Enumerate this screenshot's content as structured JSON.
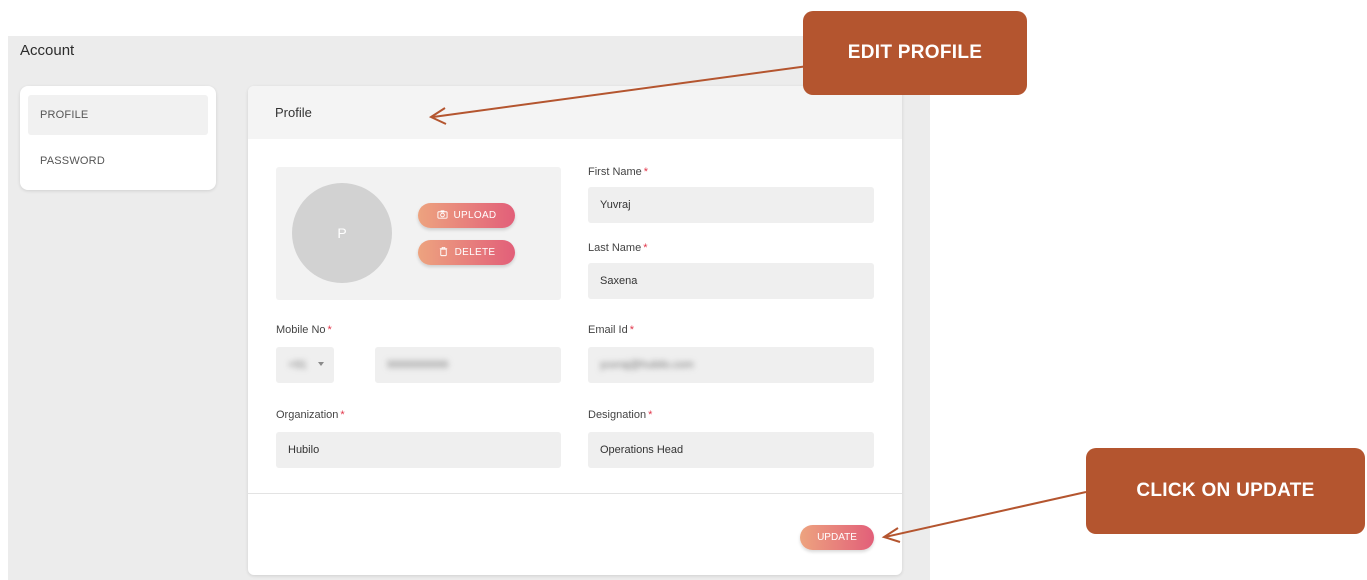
{
  "page": {
    "title": "Account"
  },
  "sidebar": {
    "items": [
      {
        "label": "PROFILE",
        "active": true
      },
      {
        "label": "PASSWORD",
        "active": false
      }
    ]
  },
  "profile_card": {
    "header": "Profile",
    "avatar_initial": "P",
    "upload_label": "UPLOAD",
    "delete_label": "DELETE",
    "required_mark": "*",
    "fields": {
      "first_name": {
        "label": "First Name",
        "value": "Yuvraj"
      },
      "last_name": {
        "label": "Last Name",
        "value": "Saxena"
      },
      "mobile": {
        "label": "Mobile No",
        "country_code": "+91",
        "value": "9999999999"
      },
      "email": {
        "label": "Email Id",
        "value": "yuvraj@hubilo.com"
      },
      "organization": {
        "label": "Organization",
        "value": "Hubilo"
      },
      "designation": {
        "label": "Designation",
        "value": "Operations Head"
      }
    },
    "update_label": "UPDATE"
  },
  "callouts": {
    "edit_profile": "EDIT PROFILE",
    "click_update": "CLICK ON UPDATE"
  },
  "colors": {
    "accent_start": "#eda37f",
    "accent_end": "#e25f79",
    "callout": "#b4552f",
    "required": "#e2364a"
  },
  "icons": {
    "upload": "camera-icon",
    "delete": "trash-icon",
    "country_select": "chevron-down-icon"
  }
}
